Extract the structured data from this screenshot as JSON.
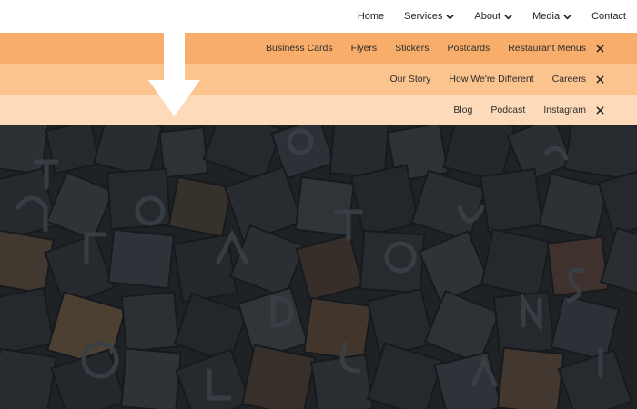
{
  "nav": {
    "items": [
      {
        "label": "Home",
        "dropdown": false
      },
      {
        "label": "Services",
        "dropdown": true
      },
      {
        "label": "About",
        "dropdown": true
      },
      {
        "label": "Media",
        "dropdown": true
      },
      {
        "label": "Contact",
        "dropdown": false
      }
    ]
  },
  "submenus": {
    "services": [
      "Business Cards",
      "Flyers",
      "Stickers",
      "Postcards",
      "Restaurant Menus"
    ],
    "about": [
      "Our Story",
      "How We're Different",
      "Careers"
    ],
    "media": [
      "Blog",
      "Podcast",
      "Instagram"
    ]
  },
  "colors": {
    "submenu_services_bg": "#f8ad6a",
    "submenu_about_bg": "#fbc48e",
    "submenu_media_bg": "#fddab9",
    "arrow": "#ffffff",
    "hero_tint": "#26292d"
  },
  "icons": {
    "dropdown": "chevron-down-icon",
    "close": "close-icon",
    "indicator": "down-arrow-icon"
  }
}
